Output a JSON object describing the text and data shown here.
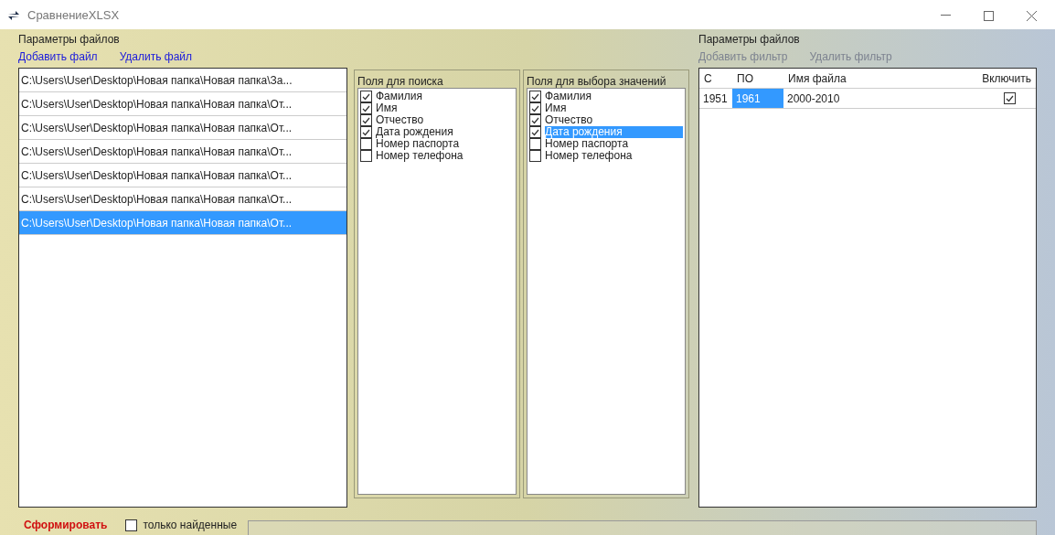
{
  "window": {
    "title": "СравнениеXLSX"
  },
  "left_panel": {
    "title": "Параметры файлов",
    "links": [
      {
        "label": "Добавить файл",
        "disabled": false
      },
      {
        "label": "Удалить файл",
        "disabled": false
      }
    ],
    "files": [
      {
        "path": "C:\\Users\\User\\Desktop\\Новая папка\\Новая папка\\За...",
        "selected": false
      },
      {
        "path": "C:\\Users\\User\\Desktop\\Новая папка\\Новая папка\\От...",
        "selected": false
      },
      {
        "path": "C:\\Users\\User\\Desktop\\Новая папка\\Новая папка\\От...",
        "selected": false
      },
      {
        "path": "C:\\Users\\User\\Desktop\\Новая папка\\Новая папка\\От...",
        "selected": false
      },
      {
        "path": "C:\\Users\\User\\Desktop\\Новая папка\\Новая папка\\От...",
        "selected": false
      },
      {
        "path": "C:\\Users\\User\\Desktop\\Новая папка\\Новая папка\\От...",
        "selected": false
      },
      {
        "path": "C:\\Users\\User\\Desktop\\Новая папка\\Новая папка\\От...",
        "selected": true
      }
    ]
  },
  "field_groups": [
    {
      "title": "Поля для поиска",
      "items": [
        {
          "label": "Фамилия",
          "checked": true,
          "selected": false
        },
        {
          "label": "Имя",
          "checked": true,
          "selected": false
        },
        {
          "label": "Отчество",
          "checked": true,
          "selected": false
        },
        {
          "label": "Дата рождения",
          "checked": true,
          "selected": false
        },
        {
          "label": "Номер паспорта",
          "checked": false,
          "selected": false
        },
        {
          "label": "Номер телефона",
          "checked": false,
          "selected": false
        }
      ]
    },
    {
      "title": "Поля для выбора значений",
      "items": [
        {
          "label": "Фамилия",
          "checked": true,
          "selected": false
        },
        {
          "label": "Имя",
          "checked": true,
          "selected": false
        },
        {
          "label": "Отчество",
          "checked": true,
          "selected": false
        },
        {
          "label": "Дата рождения",
          "checked": true,
          "selected": true
        },
        {
          "label": "Номер паспорта",
          "checked": false,
          "selected": false
        },
        {
          "label": "Номер телефона",
          "checked": false,
          "selected": false
        }
      ]
    }
  ],
  "right_panel": {
    "title": "Параметры файлов",
    "links": [
      {
        "label": "Добавить фильтр",
        "disabled": true
      },
      {
        "label": "Удалить фильтр",
        "disabled": true
      }
    ],
    "table": {
      "columns": [
        "С",
        "ПО",
        "Имя файла",
        "Включить"
      ],
      "rows": [
        {
          "cells": [
            {
              "text": "1951",
              "selected": false
            },
            {
              "text": "1961",
              "selected": true
            },
            {
              "text": "2000-2010",
              "selected": false
            }
          ],
          "enabled": true
        }
      ]
    }
  },
  "bottom": {
    "button": "Сформировать",
    "only_found": {
      "label": "только найденные",
      "checked": false
    }
  }
}
